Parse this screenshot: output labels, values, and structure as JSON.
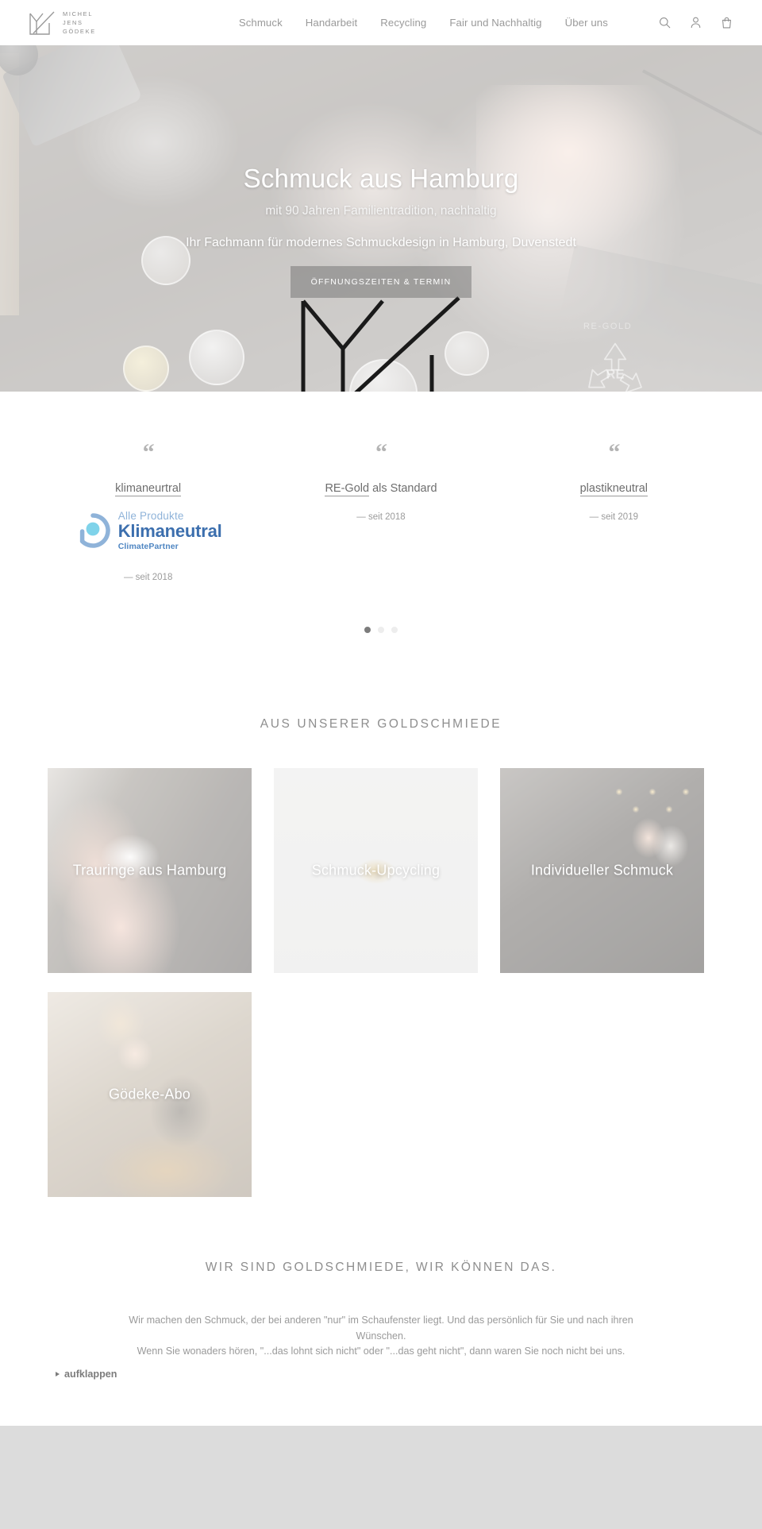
{
  "header": {
    "brand": {
      "logo_icon": "mjg-monogram-logo",
      "lines": [
        "MICHEL",
        "JENS",
        "GÖDEKE"
      ]
    },
    "nav": [
      {
        "label": "Schmuck"
      },
      {
        "label": "Handarbeit"
      },
      {
        "label": "Recycling"
      },
      {
        "label": "Fair und Nachhaltig"
      },
      {
        "label": "Über uns"
      }
    ],
    "icons": [
      {
        "name": "search-icon"
      },
      {
        "name": "account-icon"
      },
      {
        "name": "cart-icon"
      }
    ]
  },
  "hero": {
    "title": "Schmuck aus Hamburg",
    "subtitle": "mit 90 Jahren Familientradition, nachhaltig",
    "lead": "Ihr Fachmann für modernes Schmuckdesign in Hamburg, Duvenstedt",
    "cta_label": "ÖFFNUNGSZEITEN & TERMIN",
    "badge_caption": "RE-GOLD",
    "badge_center": "RE"
  },
  "quotes": {
    "mark": "“",
    "items": [
      {
        "text_underlined": "klimaneurtral",
        "text_rest": "",
        "meta": "— seit 2018",
        "logo": {
          "name": "climatepartner-logo",
          "line1": "Alle Produkte",
          "line2": "Klimaneutral",
          "line3": "ClimatePartner"
        }
      },
      {
        "text_underlined": "RE-Gold",
        "text_rest": " als Standard",
        "meta": "— seit 2018"
      },
      {
        "text_underlined": "plastikneutral",
        "text_rest": "",
        "meta": "— seit 2019"
      }
    ],
    "dots": [
      {
        "active": true
      },
      {
        "active": false
      },
      {
        "active": false
      }
    ]
  },
  "goldsmith": {
    "heading": "AUS UNSERER GOLDSCHMIEDE",
    "cards": [
      {
        "title": "Trauringe aus Hamburg",
        "bg": "bg-trauringe"
      },
      {
        "title": "Schmuck-Upcycling",
        "bg": "bg-upcycling"
      },
      {
        "title": "Individueller Schmuck",
        "bg": "bg-individuell"
      },
      {
        "title": "Gödeke-Abo",
        "bg": "bg-abo"
      }
    ]
  },
  "about": {
    "heading": "WIR SIND GOLDSCHMIEDE, WIR KÖNNEN DAS.",
    "paragraph_line1": "Wir machen den Schmuck, der bei anderen \"nur\" im Schaufenster liegt. Und das persönlich für Sie und nach ihren Wünschen.",
    "paragraph_line2": "Wenn Sie wonaders hören, \"...das lohnt sich nicht\" oder \"...das geht nicht\", dann waren Sie noch nicht bei uns.",
    "disclosure_label": "aufklappen"
  },
  "colors": {
    "nav_text": "#9a9a9a",
    "heading_text": "#8e8e8e",
    "dot_active": "#7c7c7c",
    "footer_band": "#dcdcdc",
    "climatepartner_blue": "#3c6fae"
  }
}
